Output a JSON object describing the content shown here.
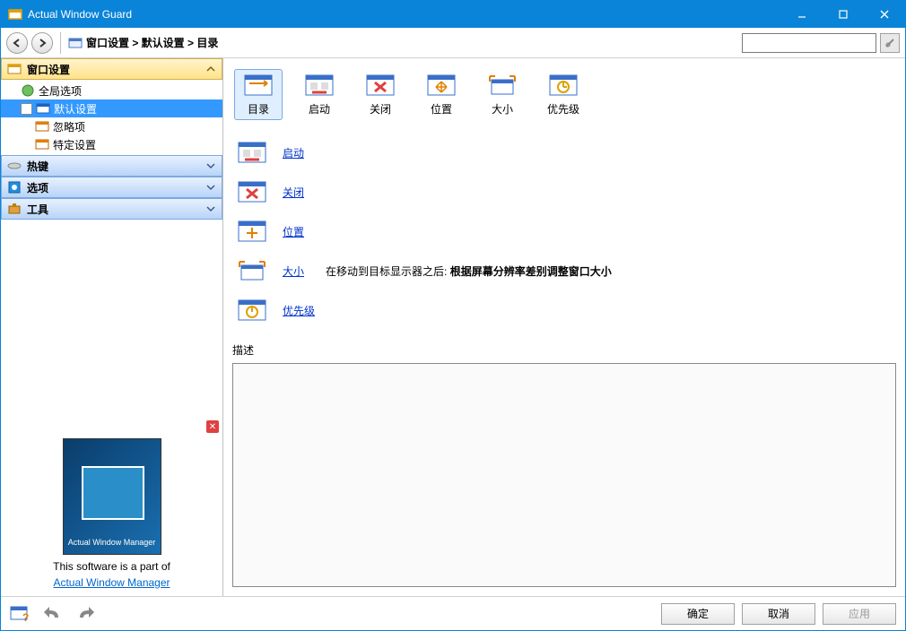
{
  "title": "Actual Window Guard",
  "breadcrumb": "窗口设置 > 默认设置 > 目录",
  "sidebar": {
    "sections": [
      {
        "label": "窗口设置",
        "expanded": true
      },
      {
        "label": "热键",
        "expanded": false
      },
      {
        "label": "选项",
        "expanded": false
      },
      {
        "label": "工具",
        "expanded": false
      }
    ],
    "tree": {
      "item0": "全局选项",
      "item1": "默认设置",
      "item2": "忽略项",
      "item3": "特定设置"
    }
  },
  "ad": {
    "box_label": "Actual\nWindow Manager",
    "text": "This software is a part of",
    "link": "Actual Window Manager"
  },
  "toolbar": {
    "items": {
      "i0": "目录",
      "i1": "启动",
      "i2": "关闭",
      "i3": "位置",
      "i4": "大小",
      "i5": "优先级"
    }
  },
  "links": {
    "l0": "启动",
    "l1": "关闭",
    "l2": "位置",
    "l3": "大小",
    "l3_desc_prefix": "在移动到目标显示器之后:",
    "l3_desc_bold": "根据屏幕分辨率差别调整窗口大小",
    "l4": "优先级"
  },
  "desc_label": "描述",
  "footer": {
    "ok": "确定",
    "cancel": "取消",
    "apply": "应用"
  }
}
